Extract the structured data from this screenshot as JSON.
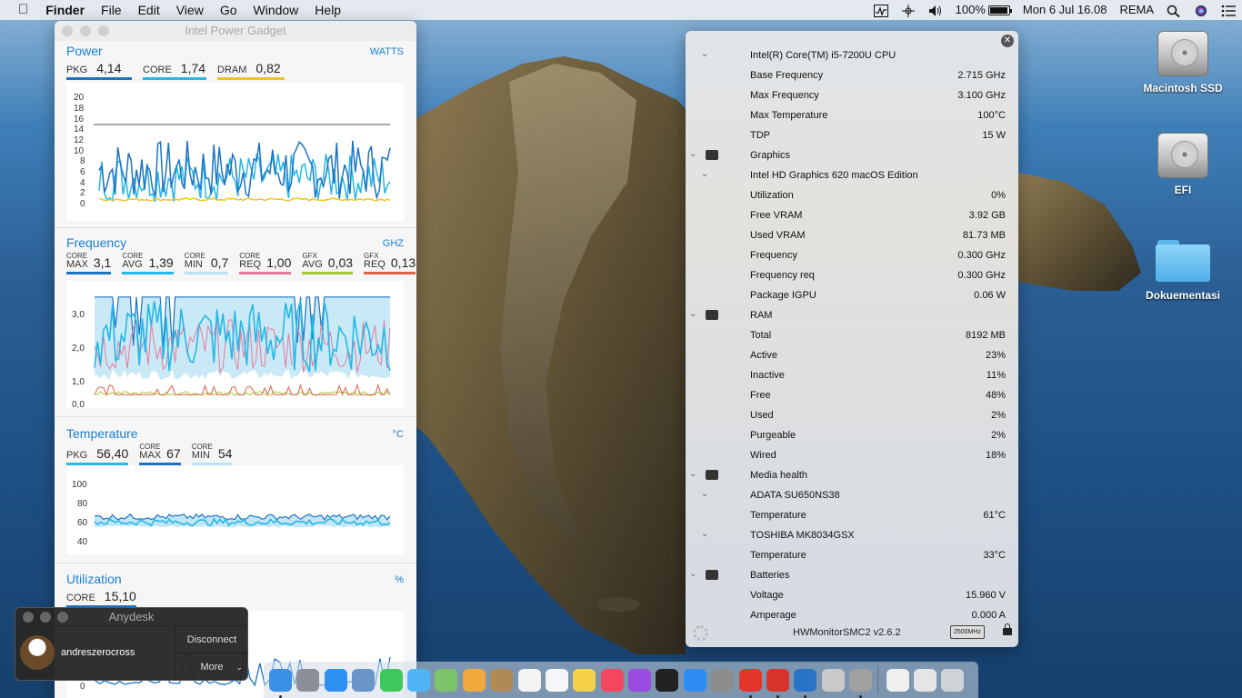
{
  "menubar": {
    "app": "Finder",
    "items": [
      "File",
      "Edit",
      "View",
      "Go",
      "Window",
      "Help"
    ],
    "battery": "100%",
    "datetime": "Mon 6 Jul  16.08",
    "user": "REMA"
  },
  "power_gadget": {
    "title": "Intel Power Gadget",
    "power": {
      "header": "Power",
      "unit": "WATTS",
      "metrics": [
        {
          "label": "PKG",
          "value": "4,14",
          "color": "#1c73c4"
        },
        {
          "label": "CORE",
          "value": "1,74",
          "color": "#25b7e6"
        },
        {
          "label": "DRAM",
          "value": "0,82",
          "color": "#f2c320"
        }
      ],
      "yticks": [
        "20",
        "18",
        "16",
        "14",
        "12",
        "10",
        "8",
        "6",
        "4",
        "2",
        "0"
      ]
    },
    "frequency": {
      "header": "Frequency",
      "unit": "GHZ",
      "metrics": [
        {
          "top": "CORE",
          "bottom": "MAX",
          "value": "3,1",
          "color": "#1c73c4"
        },
        {
          "top": "CORE",
          "bottom": "AVG",
          "value": "1,39",
          "color": "#25b7e6"
        },
        {
          "top": "CORE",
          "bottom": "MIN",
          "value": "0,7",
          "color": "#b8e2f4"
        },
        {
          "top": "CORE",
          "bottom": "REQ",
          "value": "1,00",
          "color": "#e8799a"
        },
        {
          "top": "GFX",
          "bottom": "AVG",
          "value": "0,03",
          "color": "#a6c93a"
        },
        {
          "top": "GFX",
          "bottom": "REQ",
          "value": "0,13",
          "color": "#e0634a"
        }
      ],
      "yticks": [
        "3,0",
        "2,0",
        "1,0",
        "0,0"
      ]
    },
    "temperature": {
      "header": "Temperature",
      "unit": "°C",
      "metrics": [
        {
          "label": "PKG",
          "value": "56,40",
          "color": "#25b7e6"
        },
        {
          "top": "CORE",
          "bottom": "MAX",
          "value": "67",
          "color": "#1c73c4"
        },
        {
          "top": "CORE",
          "bottom": "MIN",
          "value": "54",
          "color": "#b8e2f4"
        }
      ],
      "yticks": [
        "100",
        "80",
        "60",
        "40"
      ]
    },
    "utilization": {
      "header": "Utilization",
      "unit": "%",
      "metrics": [
        {
          "label": "CORE",
          "value": "15,10",
          "color": "#1c73c4"
        }
      ],
      "yticks": [
        "0"
      ]
    }
  },
  "hwmonitor": {
    "rows": [
      {
        "name": "Intel(R) Core(TM) i5-7200U CPU",
        "value": "",
        "chevron": "inner"
      },
      {
        "name": "Base Frequency",
        "value": "2.715 GHz"
      },
      {
        "name": "Max Frequency",
        "value": "3.100 GHz"
      },
      {
        "name": "Max Temperature",
        "value": "100°C"
      },
      {
        "name": "TDP",
        "value": "15 W"
      },
      {
        "name": "Graphics",
        "value": "",
        "chevron": "outer",
        "icon": "gpu-icon"
      },
      {
        "name": "Intel HD Graphics 620 macOS Edition",
        "value": "",
        "chevron": "inner"
      },
      {
        "name": "Utilization",
        "value": "0%"
      },
      {
        "name": "Free VRAM",
        "value": "3.92 GB"
      },
      {
        "name": "Used VRAM",
        "value": "81.73 MB"
      },
      {
        "name": "Frequency",
        "value": "0.300 GHz"
      },
      {
        "name": "Frequency req",
        "value": "0.300 GHz"
      },
      {
        "name": "Package IGPU",
        "value": "0.06 W"
      },
      {
        "name": "RAM",
        "value": "",
        "chevron": "outer",
        "icon": "ram-icon"
      },
      {
        "name": "Total",
        "value": "8192 MB"
      },
      {
        "name": "Active",
        "value": "23%"
      },
      {
        "name": "Inactive",
        "value": "11%"
      },
      {
        "name": "Free",
        "value": "48%"
      },
      {
        "name": "Used",
        "value": "2%"
      },
      {
        "name": "Purgeable",
        "value": "2%"
      },
      {
        "name": "Wired",
        "value": "18%"
      },
      {
        "name": "Media health",
        "value": "",
        "chevron": "outer",
        "icon": "disk-icon"
      },
      {
        "name": "ADATA SU650NS38",
        "value": "",
        "chevron": "inner"
      },
      {
        "name": "Temperature",
        "value": "61°C"
      },
      {
        "name": "TOSHIBA MK8034GSX",
        "value": "",
        "chevron": "inner"
      },
      {
        "name": "Temperature",
        "value": "33°C"
      },
      {
        "name": "Batteries",
        "value": "",
        "chevron": "outer",
        "icon": "battery-icon"
      },
      {
        "name": "Voltage",
        "value": "15.960 V"
      },
      {
        "name": "Amperage",
        "value": "0.000 A"
      }
    ],
    "footer": {
      "version": "HWMonitorSMC2 v2.6.2",
      "badge": "2500MHz"
    }
  },
  "desktop": {
    "icons": [
      {
        "label": "Macintosh SSD",
        "type": "disk"
      },
      {
        "label": "EFI",
        "type": "disk"
      },
      {
        "label": "Dokuementasi",
        "type": "folder"
      }
    ]
  },
  "anydesk": {
    "title": "Anydesk",
    "username": "andreszerocross",
    "disconnect": "Disconnect",
    "more": "More"
  },
  "dock": {
    "apps": [
      {
        "icon": "finder-icon",
        "color": "#3b8fe6"
      },
      {
        "icon": "launchpad-icon",
        "color": "#8a8f99"
      },
      {
        "icon": "safari-icon",
        "color": "#2d8ff0"
      },
      {
        "icon": "preview-icon",
        "color": "#6a95c7"
      },
      {
        "icon": "facetime-icon",
        "color": "#3dc95b"
      },
      {
        "icon": "messages-icon",
        "color": "#4fb3f5"
      },
      {
        "icon": "maps-icon",
        "color": "#7cc36a"
      },
      {
        "icon": "photos-icon",
        "color": "#f2a93b"
      },
      {
        "icon": "contacts-icon",
        "color": "#b08a55"
      },
      {
        "icon": "calendar-icon",
        "color": "#f4f4f4"
      },
      {
        "icon": "reminders-icon",
        "color": "#f6f6f6"
      },
      {
        "icon": "notes-icon",
        "color": "#f5d24a"
      },
      {
        "icon": "music-icon",
        "color": "#f4475f"
      },
      {
        "icon": "podcasts-icon",
        "color": "#9b4be0"
      },
      {
        "icon": "tv-icon",
        "color": "#222222"
      },
      {
        "icon": "app-store-icon",
        "color": "#2f8cf2"
      },
      {
        "icon": "system-preferences-icon",
        "color": "#8c8c8c"
      },
      {
        "icon": "anydesk-icon",
        "color": "#e2362d"
      },
      {
        "icon": "anydesk-alt-icon",
        "color": "#d8332b"
      },
      {
        "icon": "power-gadget-icon",
        "color": "#2a74c8"
      },
      {
        "icon": "script-editor-icon",
        "color": "#c9c9c9"
      },
      {
        "icon": "hwmonitor-icon",
        "color": "#a0a0a0"
      },
      {
        "icon": "documents-icon",
        "color": "#efefef"
      },
      {
        "icon": "screenshots-icon",
        "color": "#e5e5e5"
      },
      {
        "icon": "trash-icon",
        "color": "#cfd3d8"
      }
    ]
  }
}
